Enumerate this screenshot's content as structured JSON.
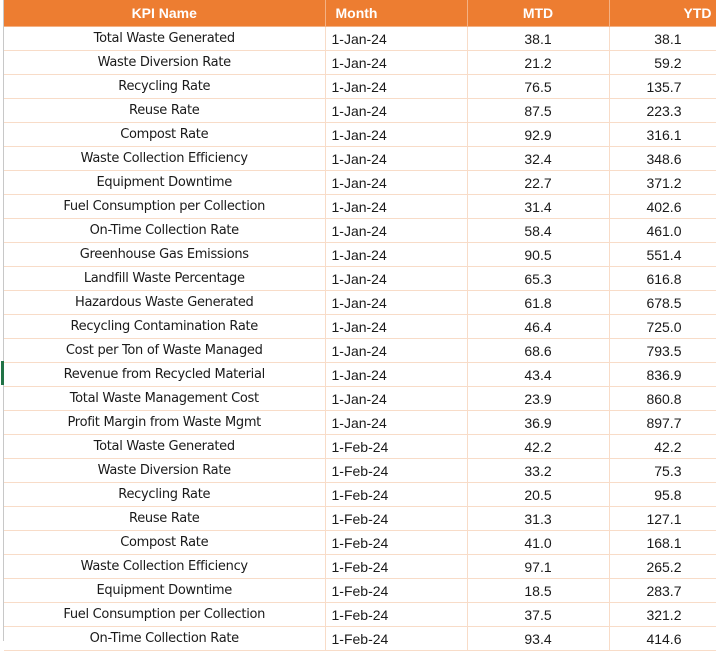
{
  "sheet": {
    "headers": {
      "kpi_name": "KPI Name",
      "month": "Month",
      "mtd": "MTD",
      "ytd": "YTD"
    },
    "header_color": "#ed7d31",
    "rows": [
      {
        "kpi": "Total Waste Generated",
        "month": "1-Jan-24",
        "mtd": "38.1",
        "ytd": "38.1"
      },
      {
        "kpi": "Waste Diversion Rate",
        "month": "1-Jan-24",
        "mtd": "21.2",
        "ytd": "59.2"
      },
      {
        "kpi": "Recycling Rate",
        "month": "1-Jan-24",
        "mtd": "76.5",
        "ytd": "135.7"
      },
      {
        "kpi": "Reuse Rate",
        "month": "1-Jan-24",
        "mtd": "87.5",
        "ytd": "223.3"
      },
      {
        "kpi": "Compost Rate",
        "month": "1-Jan-24",
        "mtd": "92.9",
        "ytd": "316.1"
      },
      {
        "kpi": "Waste Collection Efficiency",
        "month": "1-Jan-24",
        "mtd": "32.4",
        "ytd": "348.6"
      },
      {
        "kpi": "Equipment Downtime",
        "month": "1-Jan-24",
        "mtd": "22.7",
        "ytd": "371.2"
      },
      {
        "kpi": "Fuel Consumption per Collection",
        "month": "1-Jan-24",
        "mtd": "31.4",
        "ytd": "402.6"
      },
      {
        "kpi": "On-Time Collection Rate",
        "month": "1-Jan-24",
        "mtd": "58.4",
        "ytd": "461.0"
      },
      {
        "kpi": "Greenhouse Gas Emissions",
        "month": "1-Jan-24",
        "mtd": "90.5",
        "ytd": "551.4"
      },
      {
        "kpi": "Landfill Waste Percentage",
        "month": "1-Jan-24",
        "mtd": "65.3",
        "ytd": "616.8"
      },
      {
        "kpi": "Hazardous Waste Generated",
        "month": "1-Jan-24",
        "mtd": "61.8",
        "ytd": "678.5"
      },
      {
        "kpi": "Recycling Contamination Rate",
        "month": "1-Jan-24",
        "mtd": "46.4",
        "ytd": "725.0"
      },
      {
        "kpi": "Cost per Ton of Waste Managed",
        "month": "1-Jan-24",
        "mtd": "68.6",
        "ytd": "793.5"
      },
      {
        "kpi": "Revenue from Recycled Material",
        "month": "1-Jan-24",
        "mtd": "43.4",
        "ytd": "836.9"
      },
      {
        "kpi": "Total Waste Management Cost",
        "month": "1-Jan-24",
        "mtd": "23.9",
        "ytd": "860.8"
      },
      {
        "kpi": "Profit Margin from Waste Mgmt",
        "month": "1-Jan-24",
        "mtd": "36.9",
        "ytd": "897.7"
      },
      {
        "kpi": "Total Waste Generated",
        "month": "1-Feb-24",
        "mtd": "42.2",
        "ytd": "42.2"
      },
      {
        "kpi": "Waste Diversion Rate",
        "month": "1-Feb-24",
        "mtd": "33.2",
        "ytd": "75.3"
      },
      {
        "kpi": "Recycling Rate",
        "month": "1-Feb-24",
        "mtd": "20.5",
        "ytd": "95.8"
      },
      {
        "kpi": "Reuse Rate",
        "month": "1-Feb-24",
        "mtd": "31.3",
        "ytd": "127.1"
      },
      {
        "kpi": "Compost Rate",
        "month": "1-Feb-24",
        "mtd": "41.0",
        "ytd": "168.1"
      },
      {
        "kpi": "Waste Collection Efficiency",
        "month": "1-Feb-24",
        "mtd": "97.1",
        "ytd": "265.2"
      },
      {
        "kpi": "Equipment Downtime",
        "month": "1-Feb-24",
        "mtd": "18.5",
        "ytd": "283.7"
      },
      {
        "kpi": "Fuel Consumption per Collection",
        "month": "1-Feb-24",
        "mtd": "37.5",
        "ytd": "321.2"
      },
      {
        "kpi": "On-Time Collection Rate",
        "month": "1-Feb-24",
        "mtd": "93.4",
        "ytd": "414.6"
      }
    ]
  }
}
